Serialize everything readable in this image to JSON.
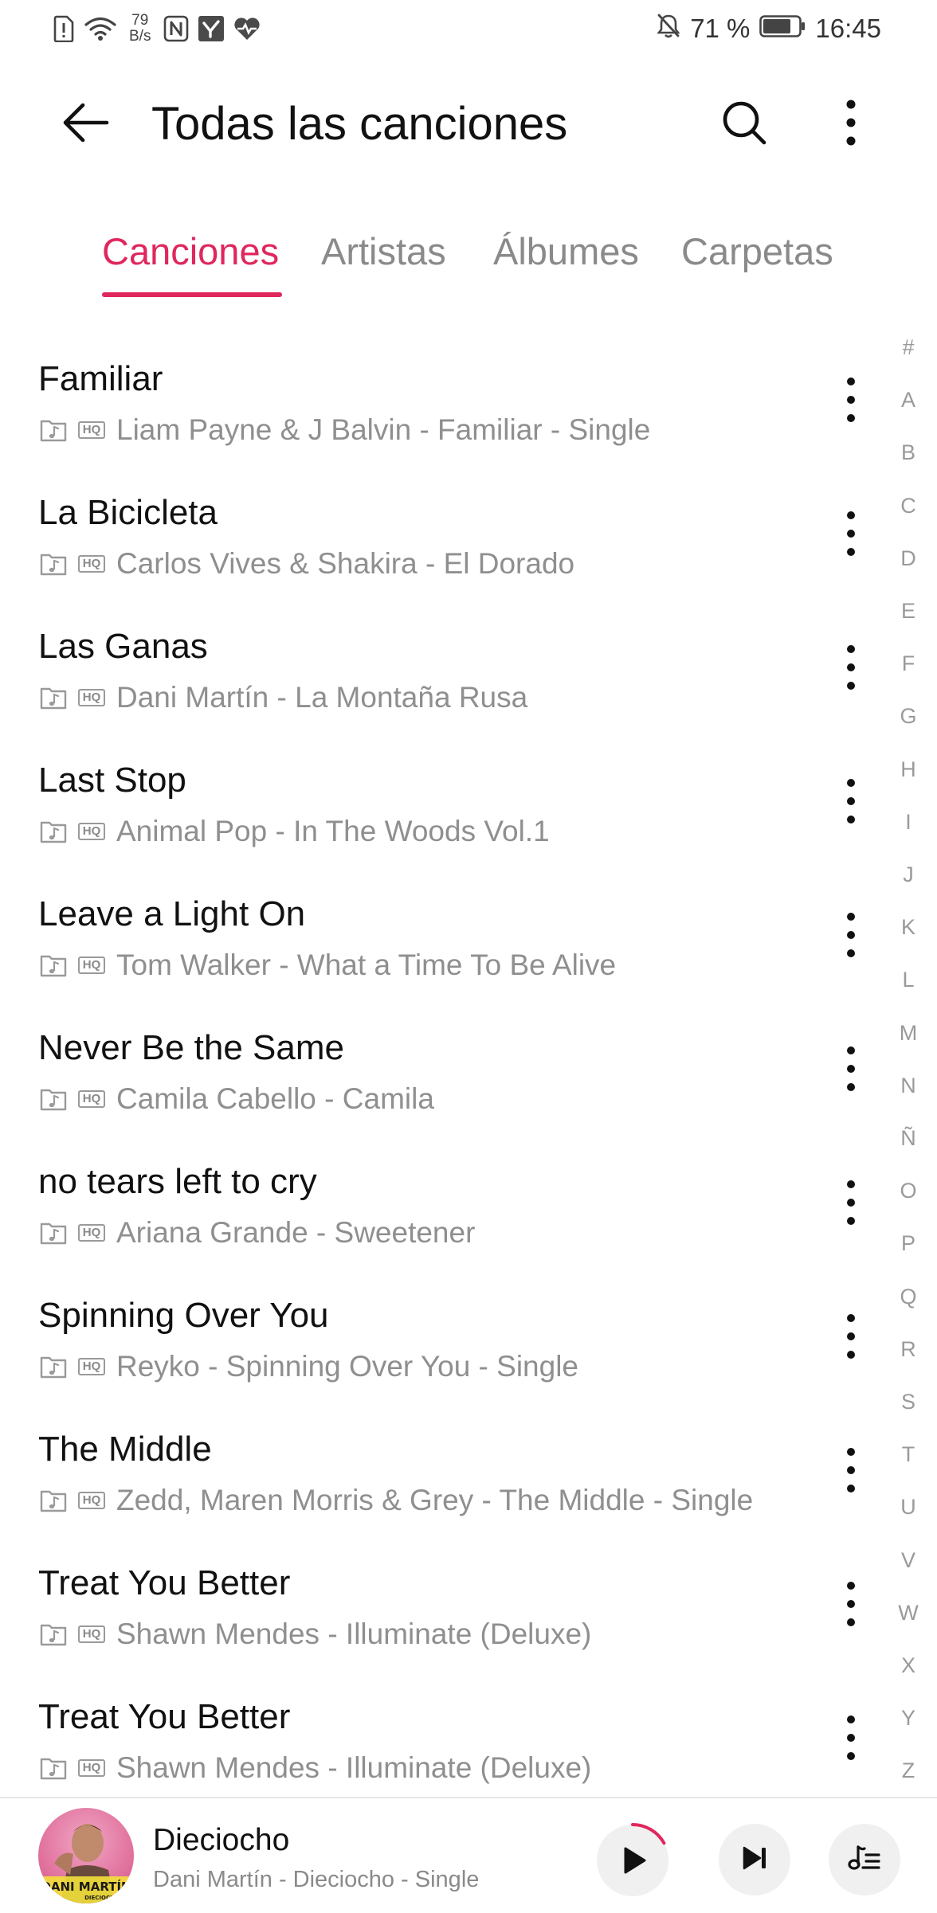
{
  "status_bar": {
    "net_speed_value": "79",
    "net_speed_unit": "B/s",
    "battery_percent": "71 %",
    "time": "16:45",
    "icons": [
      "sim-alert-icon",
      "wifi-icon",
      "nfc-icon",
      "app-notification-icon",
      "health-icon",
      "silent-bell-icon",
      "battery-icon"
    ]
  },
  "header": {
    "title": "Todas las canciones",
    "back_icon": "arrow-left-icon",
    "search_icon": "search-icon",
    "more_icon": "more-vertical-icon"
  },
  "tabs": [
    {
      "label": "Canciones",
      "active": true
    },
    {
      "label": "Artistas",
      "active": false
    },
    {
      "label": "Álbumes",
      "active": false
    },
    {
      "label": "Carpetas",
      "active": false
    }
  ],
  "accent_color": "#e0275d",
  "songs": [
    {
      "title": "Familiar",
      "subtitle": "Liam Payne & J Balvin - Familiar - Single",
      "quality_badge": "HQ"
    },
    {
      "title": "La Bicicleta",
      "subtitle": "Carlos Vives & Shakira - El Dorado",
      "quality_badge": "HQ"
    },
    {
      "title": "Las Ganas",
      "subtitle": "Dani Martín - La Montaña Rusa",
      "quality_badge": "HQ"
    },
    {
      "title": "Last Stop",
      "subtitle": "Animal Pop - In The Woods Vol.1",
      "quality_badge": "HQ"
    },
    {
      "title": "Leave a Light On",
      "subtitle": "Tom Walker - What a Time To Be Alive",
      "quality_badge": "HQ"
    },
    {
      "title": "Never Be the Same",
      "subtitle": "Camila Cabello - Camila",
      "quality_badge": "HQ"
    },
    {
      "title": "no tears left to cry",
      "subtitle": "Ariana Grande - Sweetener",
      "quality_badge": "HQ"
    },
    {
      "title": "Spinning Over You",
      "subtitle": "Reyko - Spinning Over You - Single",
      "quality_badge": "HQ"
    },
    {
      "title": "The Middle",
      "subtitle": "Zedd, Maren Morris & Grey - The Middle - Single",
      "quality_badge": "HQ"
    },
    {
      "title": "Treat You Better",
      "subtitle": "Shawn Mendes - Illuminate (Deluxe)",
      "quality_badge": "HQ"
    },
    {
      "title": "Treat You Better",
      "subtitle": "Shawn Mendes - Illuminate (Deluxe)",
      "quality_badge": "HQ"
    }
  ],
  "alphabet_index": [
    "#",
    "A",
    "B",
    "C",
    "D",
    "E",
    "F",
    "G",
    "H",
    "I",
    "J",
    "K",
    "L",
    "M",
    "N",
    "Ñ",
    "O",
    "P",
    "Q",
    "R",
    "S",
    "T",
    "U",
    "V",
    "W",
    "X",
    "Y",
    "Z"
  ],
  "now_playing": {
    "title": "Dieciocho",
    "subtitle": "Dani Martín - Dieciocho - Single",
    "album_art_text": "DANI MARTÍN",
    "album_art_subtext": "DIECIOCHO",
    "progress": 0.17,
    "icons": [
      "play-icon",
      "skip-next-icon",
      "queue-music-icon"
    ]
  }
}
